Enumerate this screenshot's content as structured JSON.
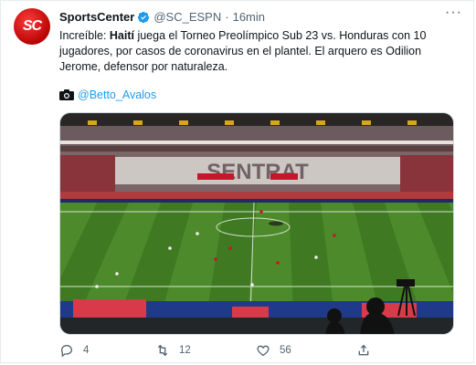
{
  "author": {
    "name": "SportsCenter",
    "handle": "@SC_ESPN",
    "separator": "·",
    "time": "16min",
    "avatar_text": "SC"
  },
  "tweet": {
    "text_start": "Increíble: ",
    "text_bold": "Haití",
    "text_rest": " juega el Torneo Preolímpico Sub 23 vs. Honduras con 10 jugadores, por casos de coronavirus en el plantel. El arquero es Odilion Jerome, defensor por naturaleza.",
    "credit": "@Betto_Avalos"
  },
  "actions": {
    "replies": "4",
    "retweets": "12",
    "likes": "56"
  },
  "icons": [
    "verified-badge-icon",
    "more-icon",
    "camera-icon",
    "reply-icon",
    "retweet-icon",
    "like-icon",
    "share-icon"
  ],
  "colors": {
    "accent": "#1d9bf0",
    "muted": "#536471",
    "brand": "#d10000"
  }
}
